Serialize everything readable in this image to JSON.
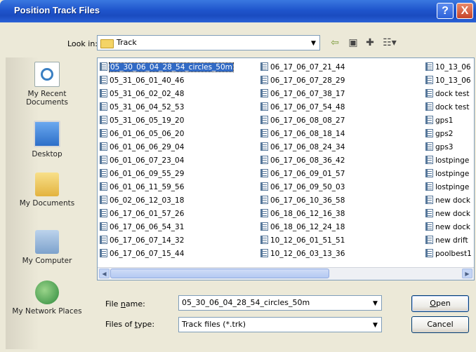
{
  "window": {
    "title": "Position Track Files",
    "help_label": "?",
    "close_label": "X"
  },
  "toolbar": {
    "lookin_label": "Look in:",
    "lookin_value": "Track",
    "icons": [
      "back-icon",
      "up-folder-icon",
      "new-folder-icon",
      "views-menu-icon"
    ]
  },
  "places": [
    {
      "label": "My Recent Documents",
      "icon": "recent-documents-icon"
    },
    {
      "label": "Desktop",
      "icon": "desktop-icon"
    },
    {
      "label": "My Documents",
      "icon": "my-documents-icon"
    },
    {
      "label": "My Computer",
      "icon": "my-computer-icon"
    },
    {
      "label": "My Network Places",
      "icon": "network-places-icon"
    }
  ],
  "files": {
    "column1": [
      "05_30_06_04_28_54_circles_50m",
      "05_31_06_01_40_46",
      "05_31_06_02_02_48",
      "05_31_06_04_52_53",
      "05_31_06_05_19_20",
      "06_01_06_05_06_20",
      "06_01_06_06_29_04",
      "06_01_06_07_23_04",
      "06_01_06_09_55_29",
      "06_01_06_11_59_56",
      "06_02_06_12_03_18",
      "06_17_06_01_57_26",
      "06_17_06_06_54_31",
      "06_17_06_07_14_32",
      "06_17_06_07_15_44"
    ],
    "column2": [
      "06_17_06_07_21_44",
      "06_17_06_07_28_29",
      "06_17_06_07_38_17",
      "06_17_06_07_54_48",
      "06_17_06_08_08_27",
      "06_17_06_08_18_14",
      "06_17_06_08_24_34",
      "06_17_06_08_36_42",
      "06_17_06_09_01_57",
      "06_17_06_09_50_03",
      "06_17_06_10_36_58",
      "06_18_06_12_16_38",
      "06_18_06_12_24_18",
      "10_12_06_01_51_51",
      "10_12_06_03_13_36"
    ],
    "column3": [
      "10_13_06",
      "10_13_06",
      "dock test",
      "dock test",
      "gps1",
      "gps2",
      "gps3",
      "lostpinge",
      "lostpinge",
      "lostpinge",
      "new dock",
      "new dock",
      "new dock",
      "new drift",
      "poolbest1"
    ],
    "selected": "05_30_06_04_28_54_circles_50m"
  },
  "form": {
    "filename_label_pre": "File ",
    "filename_label_u": "n",
    "filename_label_post": "ame:",
    "filename_value": "05_30_06_04_28_54_circles_50m",
    "filetype_label_pre": "Files of ",
    "filetype_label_u": "t",
    "filetype_label_post": "ype:",
    "filetype_value": "Track files (*.trk)",
    "open_label_u": "O",
    "open_label_post": "pen",
    "cancel_label": "Cancel"
  }
}
